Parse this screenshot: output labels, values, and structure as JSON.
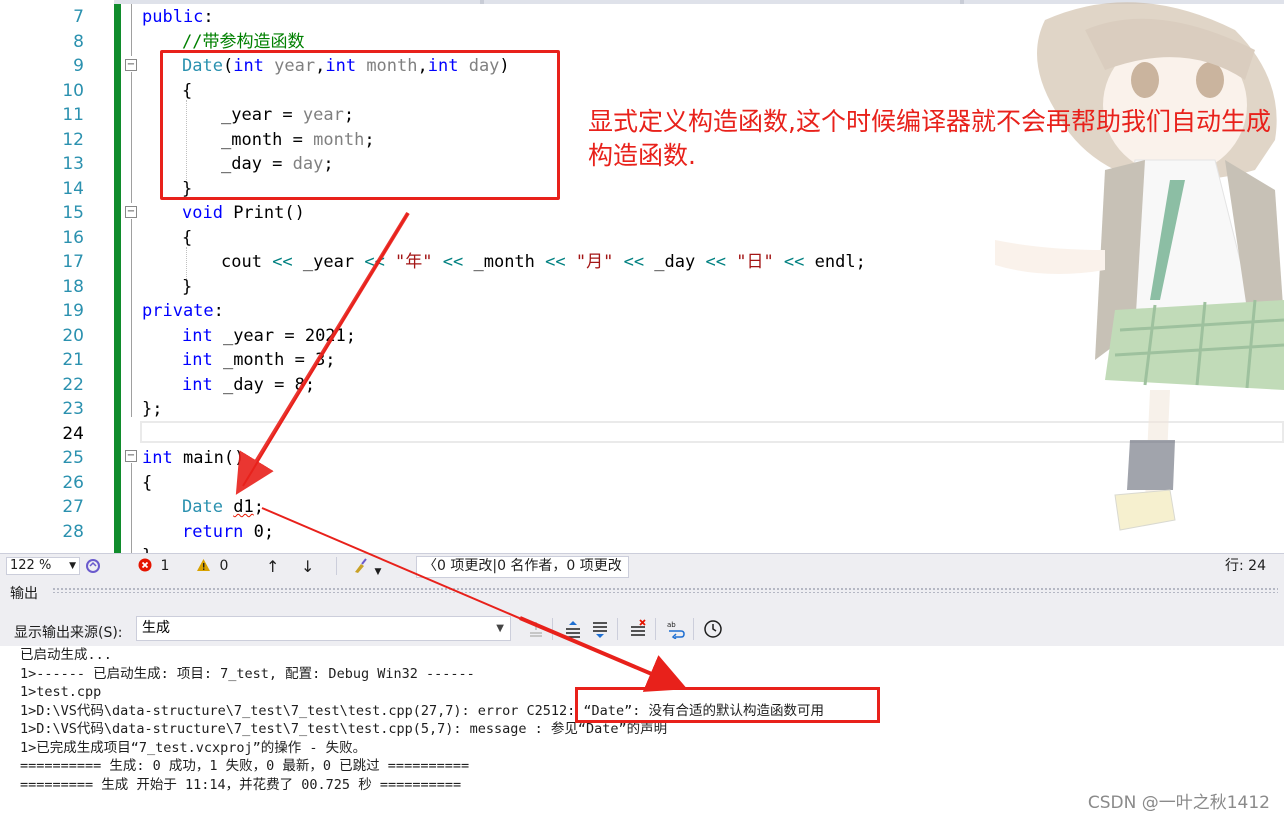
{
  "editor": {
    "line_numbers": [
      "7",
      "8",
      "9",
      "10",
      "11",
      "12",
      "13",
      "14",
      "15",
      "16",
      "17",
      "18",
      "19",
      "20",
      "21",
      "22",
      "23",
      "24",
      "25",
      "26",
      "27",
      "28"
    ],
    "current_line": "24",
    "code": {
      "l7_public": "public",
      "l7_colon": ":",
      "l8_comment": "//带参构造函数",
      "l9_type": "Date",
      "l9_a": "(",
      "l9_int1": "int",
      "l9_p1": " year",
      "l9_c1": ",",
      "l9_int2": "int",
      "l9_p2": " month",
      "l9_c2": ",",
      "l9_int3": "int",
      "l9_p3": " day",
      "l9_close": ")",
      "l10": "{",
      "l11_a": "_year = ",
      "l11_b": "year",
      "l11_c": ";",
      "l12_a": "_month = ",
      "l12_b": "month",
      "l12_c": ";",
      "l13_a": "_day = ",
      "l13_b": "day",
      "l13_c": ";",
      "l14": "}",
      "l15_void": "void",
      "l15_rest": " Print()",
      "l16": "{",
      "l17_a": "cout ",
      "l17_op1": "<<",
      "l17_b": " _year ",
      "l17_op2": "<<",
      "l17_s1": " \"年\" ",
      "l17_op3": "<<",
      "l17_c": " _month ",
      "l17_op4": "<<",
      "l17_s2": " \"月\" ",
      "l17_op5": "<<",
      "l17_d": " _day ",
      "l17_op6": "<<",
      "l17_s3": " \"日\" ",
      "l17_op7": "<<",
      "l17_e": " endl;",
      "l18": "}",
      "l19_private": "private",
      "l19_colon": ":",
      "l20_int": "int",
      "l20_rest": " _year = 2021;",
      "l21_int": "int",
      "l21_rest": " _month = 3;",
      "l22_int": "int",
      "l22_rest": " _day = 8;",
      "l23": "};",
      "l25_int": "int",
      "l25_rest": " main()",
      "l26": "{",
      "l27_type": "Date",
      "l27_sp": " ",
      "l27_var": "d1",
      "l27_semi": ";",
      "l28_return": "return",
      "l28_rest": " 0;",
      "l29": "}"
    },
    "annotation": "显式定义构造函数,这个时候编译器就不会再帮助我们自动生成构造函数."
  },
  "statusbar": {
    "zoom": "122 %",
    "errors": "1",
    "warnings": "0",
    "up_arrow": "↑",
    "down_arrow": "↓",
    "changes": "0 项更改|0 名作者，0 项更改",
    "line_indicator": "行: 24"
  },
  "output": {
    "title": "输出",
    "source_label": "显示输出来源(S):",
    "source_value": "生成",
    "lines": [
      "已启动生成...",
      "1>------ 已启动生成: 项目: 7_test, 配置: Debug Win32 ------",
      "1>test.cpp",
      "1>D:\\VS代码\\data-structure\\7_test\\7_test\\test.cpp(27,7): error C2512: “Date”: 没有合适的默认构造函数可用",
      "1>D:\\VS代码\\data-structure\\7_test\\7_test\\test.cpp(5,7): message : 参见“Date”的声明",
      "1>已完成生成项目“7_test.vcxproj”的操作 - 失败。",
      "========== 生成: 0 成功，1 失败，0 最新，0 已跳过 ==========",
      "========= 生成 开始于 11:14，并花费了 00.725 秒 =========="
    ]
  },
  "watermark": "CSDN @一叶之秋1412",
  "colors": {
    "annotation_red": "#e8211b",
    "keyword_blue": "#0000ff",
    "type_teal": "#2b91af",
    "comment_green": "#008000",
    "change_bar_green": "#108c2c"
  }
}
